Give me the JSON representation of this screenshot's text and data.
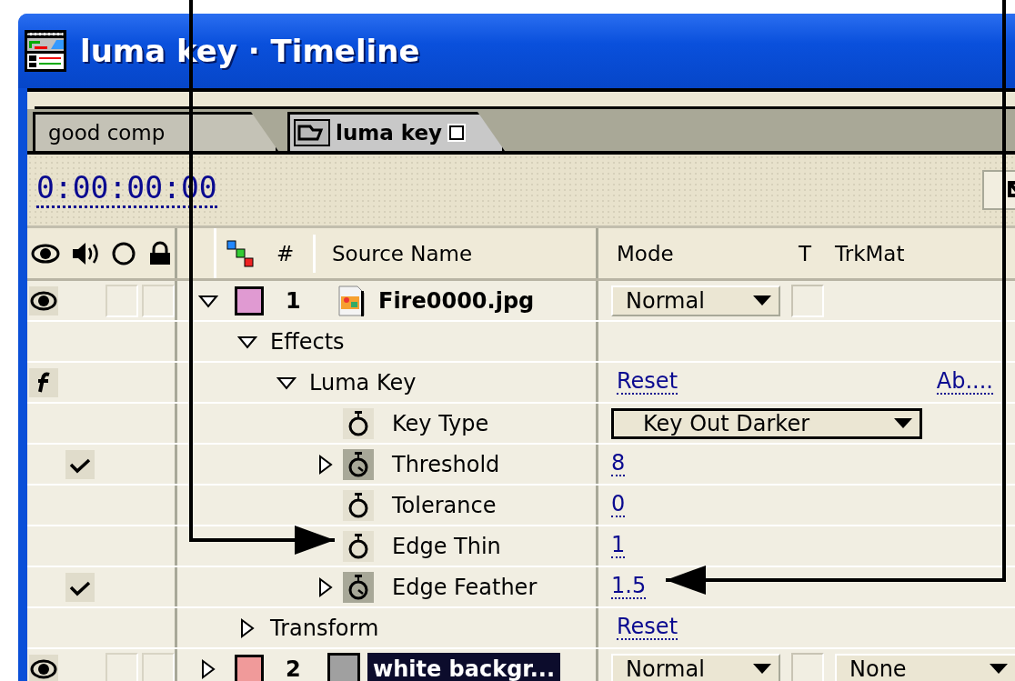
{
  "window": {
    "title": "luma key · Timeline"
  },
  "tabs": [
    {
      "label": "good comp",
      "selected": false
    },
    {
      "label": "luma key",
      "selected": true
    }
  ],
  "timecode": "0:00:00:00",
  "columns": {
    "number": "#",
    "source_name": "Source Name",
    "mode": "Mode",
    "track_matte_toggle": "T",
    "track_matte": "TrkMat"
  },
  "layers": [
    {
      "number": "1",
      "name": "Fire0000.jpg",
      "kind": "image",
      "color": "#e09ad2",
      "video": true,
      "expanded": true,
      "selected": false,
      "mode": "Normal",
      "children": [
        {
          "kind": "group",
          "name": "Effects",
          "expanded": true,
          "children": [
            {
              "kind": "effect",
              "name": "Luma Key",
              "expanded": true,
              "effect_on": true,
              "reset": "Reset",
              "about": "Ab....",
              "children": [
                {
                  "kind": "dropdown",
                  "name": "Key Type",
                  "animated": false,
                  "checked": false,
                  "value": "Key Out Darker"
                },
                {
                  "kind": "number",
                  "name": "Threshold",
                  "animated": true,
                  "checked": true,
                  "value": "8"
                },
                {
                  "kind": "number",
                  "name": "Tolerance",
                  "animated": false,
                  "checked": false,
                  "value": "0"
                },
                {
                  "kind": "number",
                  "name": "Edge Thin",
                  "animated": false,
                  "checked": false,
                  "value": "1"
                },
                {
                  "kind": "number",
                  "name": "Edge Feather",
                  "animated": true,
                  "checked": true,
                  "value": "1.5"
                }
              ]
            }
          ]
        },
        {
          "kind": "group",
          "name": "Transform",
          "expanded": false,
          "reset": "Reset"
        }
      ]
    },
    {
      "number": "2",
      "name": "white backgr...",
      "kind": "solid",
      "color": "#f09a9a",
      "video": true,
      "expanded": false,
      "selected": true,
      "mode": "Normal",
      "track_matte": "None"
    }
  ]
}
